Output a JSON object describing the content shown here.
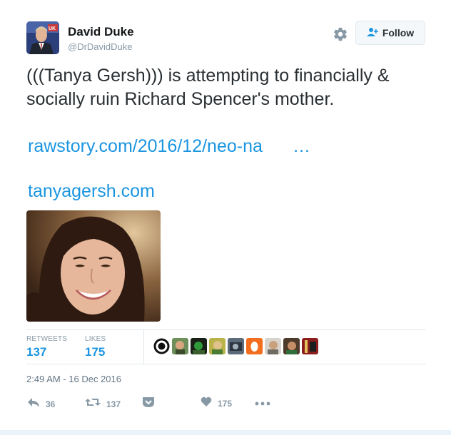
{
  "user": {
    "display_name": "David Duke",
    "screen_name": "@DrDavidDuke"
  },
  "header": {
    "follow_label": "Follow",
    "settings_icon": "gear-icon",
    "follow_icon": "add-user-icon"
  },
  "tweet": {
    "text": "(((Tanya Gersh))) is attempting to financially & socially ruin Richard Spencer's mother.",
    "link1": "rawstory.com/2016/12/neo-na",
    "link1_ellipsis": "…",
    "link2": "tanyagersh.com"
  },
  "stats": {
    "retweets_label": "RETWEETS",
    "retweets_count": "137",
    "likes_label": "LIKES",
    "likes_count": "175"
  },
  "timestamp": "2:49 AM - 16 Dec 2016",
  "actions": {
    "reply_count": "36",
    "retweet_count": "137",
    "like_count": "175"
  },
  "colors": {
    "link": "#1b95e0",
    "muted": "#8899a6"
  }
}
